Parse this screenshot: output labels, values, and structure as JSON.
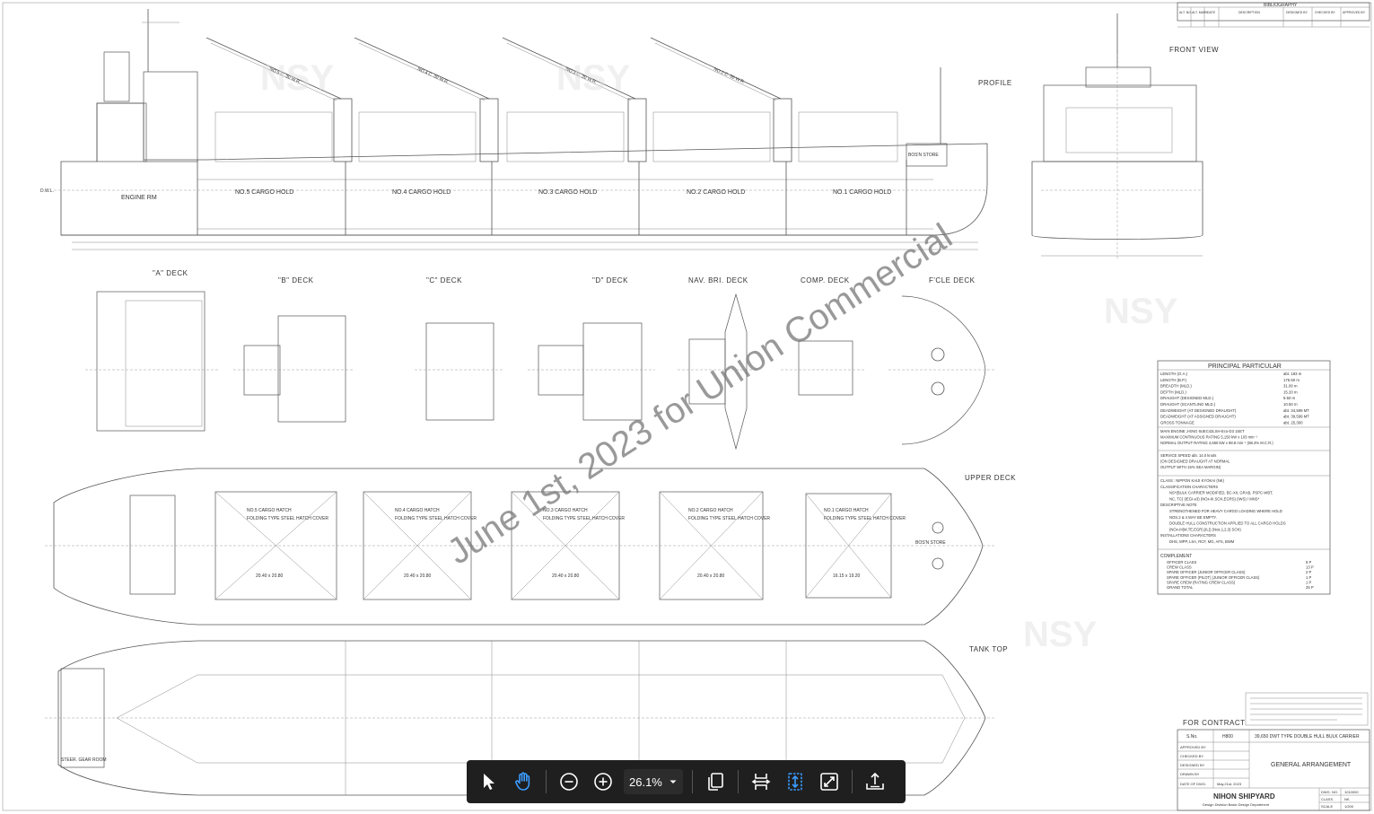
{
  "drawing": {
    "watermark": "June 1st, 2023 for Union Commercial",
    "logo_text": "NSY",
    "views": {
      "profile": "PROFILE",
      "front_view": "FRONT VIEW",
      "a_deck": "\"A\" DECK",
      "b_deck": "\"B\" DECK",
      "c_deck": "\"C\" DECK",
      "d_deck": "\"D\" DECK",
      "nav_bri_deck": "NAV. BRI. DECK",
      "comp_deck": "COMP. DECK",
      "fcle_deck": "F'CLE DECK",
      "upper_deck": "UPPER DECK",
      "tank_top": "TANK TOP"
    },
    "holds": [
      "NO.5 CARGO HOLD",
      "NO.4 CARGO HOLD",
      "NO.3 CARGO HOLD",
      "NO.2 CARGO HOLD",
      "NO.1 CARGO HOLD"
    ],
    "hatches": [
      "NO.5 CARGO HATCH",
      "NO.4 CARGO HATCH",
      "NO.3 CARGO HATCH",
      "NO.2 CARGO HATCH",
      "NO.1 CARGO HATCH"
    ],
    "hatch_cover": "FOLDING TYPE STEEL HATCH COVER",
    "hatch_sizes": [
      "20.40 x 20.80",
      "20.40 x 20.80",
      "20.40 x 20.80",
      "20.40 x 20.80",
      "16.15 x 19.20"
    ],
    "cranes": [
      "NO.5 C. 30 W.R.",
      "NO.4 C. 30 W.R.",
      "NO.3 C. 30 W.R.",
      "NO.2 C. 30 W.R."
    ],
    "engine_room": "ENGINE RM",
    "bosn_store": "BOS'N STORE",
    "steer_gear_room": "STEER. GEAR ROOM",
    "for_contract": "FOR CONTRACT"
  },
  "principal": {
    "title": "PRINCIPAL PARTICULAR",
    "rows": [
      {
        "k": "LENGTH      (O.A.)",
        "v": "abt. 183    m"
      },
      {
        "k": "LENGTH      (B.P.)",
        "v": "175.50 m"
      },
      {
        "k": "BREADTH     (MLD.)",
        "v": "31.00 m"
      },
      {
        "k": "DEPTH       (MLD.)",
        "v": "15.20 m"
      },
      {
        "k": "DRAUGHT     (DESIGNED MLD.)",
        "v": "9.50 m"
      },
      {
        "k": "DRAUGHT     (SCANTLING MLD.)",
        "v": "10.50 m"
      },
      {
        "k": "DEADWEIGHT  (AT DESIGNED DRAUGHT)",
        "v": "abt. 34,599 MT"
      },
      {
        "k": "DEADWEIGHT  (AT ASSIGNED DRAUGHT)",
        "v": "abt. 39,599 MT"
      },
      {
        "k": "GROSS TONNAGE",
        "v": "abt. 25,300"
      }
    ],
    "engine": [
      "MAIN ENGINE   J-ENG 6UEC42LSH-Eco-D3   1SET",
      "MAXIMUM CONTINUOUS RATING  5,150 kW x 103  min⁻¹",
      "NORMAL OUTPUT RATING       4,650 kW x 98.8  min⁻¹ (88.3% M.C.R.)"
    ],
    "speed": [
      "SERVICE SPEED                       abt. 14.0 knots",
      "(ON DESIGNED DRAUGHT AT NORMAL",
      " OUTPUT WITH 15% SEA MARGIN)"
    ],
    "class": [
      "CLASS : NIPPON KAIJI KYOKAI (NK)",
      "CLASSIFICATION CHARACTERS",
      "NS*(BULK CARRIER MODIFIED, BC-XII, GRAB, PSPC-WBT,",
      "NC, TC) (IEGI-e3) (NOx-III,SOX,EGRS) (IWS) / MNS*",
      "DESCRIPTIVE NOTE",
      "STRENGTHENED FOR HEAVY CARGO LOADING WHERE HOLD",
      "NOS.2 & 4 MAY BE EMPTY.",
      "DOUBLE HULL CONSTRUCTION APPLIED TO ALL CARGO HOLDS",
      "(NOx-III(M,TE,EGR),(IL)) (Nos.1,2,3) SOX)",
      "INSTALLATIONS CHARACTERS",
      "DHS, MPP, LSA, RCF, MG, AFS, BWM"
    ],
    "complement_title": "COMPLEMENT",
    "complement": [
      {
        "k": "OFFICER CLASS",
        "v": "8 P"
      },
      {
        "k": "CREW CLASS",
        "v": "13 P"
      },
      {
        "k": "SPARE OFFICER (JUNIOR OFFICER CLASS)",
        "v": "2 P"
      },
      {
        "k": "SPARE OFFICER (PILOT) (JUNIOR OFFICER CLASS)",
        "v": "1 P"
      },
      {
        "k": "SPARE CREW (RATING CREW CLASS)",
        "v": "1 P"
      },
      {
        "k": "GRAND TOTAL",
        "v": "25 P"
      }
    ]
  },
  "title_block": {
    "s_no_label": "S.No.",
    "s_no": "H800",
    "ship_type": "39,650 DWT TYPE DOUBLE HULL BULK CARRIER",
    "drawing_title": "GENERAL ARRANGEMENT",
    "approved_by": "APPROVED BY",
    "checked_by": "CHECKED BY",
    "designed_by": "DESIGNED BY",
    "drawn_by": "DRAWN BY",
    "date_label": "DATE OF DWG.",
    "date": "May.21st, 2023",
    "company": "NIHON SHIPYARD",
    "department": "Design Division   Basic Design Department",
    "dwg_no_label": "DWG. NO.",
    "dwg_no": "1010000",
    "class_label": "CLASS",
    "class_value": "NK",
    "scale_label": "SCALE",
    "scale_value": "1/200"
  },
  "bibliography": {
    "title": "BIBLIOGRAPHY",
    "cols": [
      "ALT. NO.",
      "ALT. MARK",
      "DATE",
      "DESCRIPTION",
      "DESIGNED BY",
      "CHECKED BY",
      "APPROVED BY"
    ]
  },
  "toolbar": {
    "zoom": "26.1%"
  }
}
